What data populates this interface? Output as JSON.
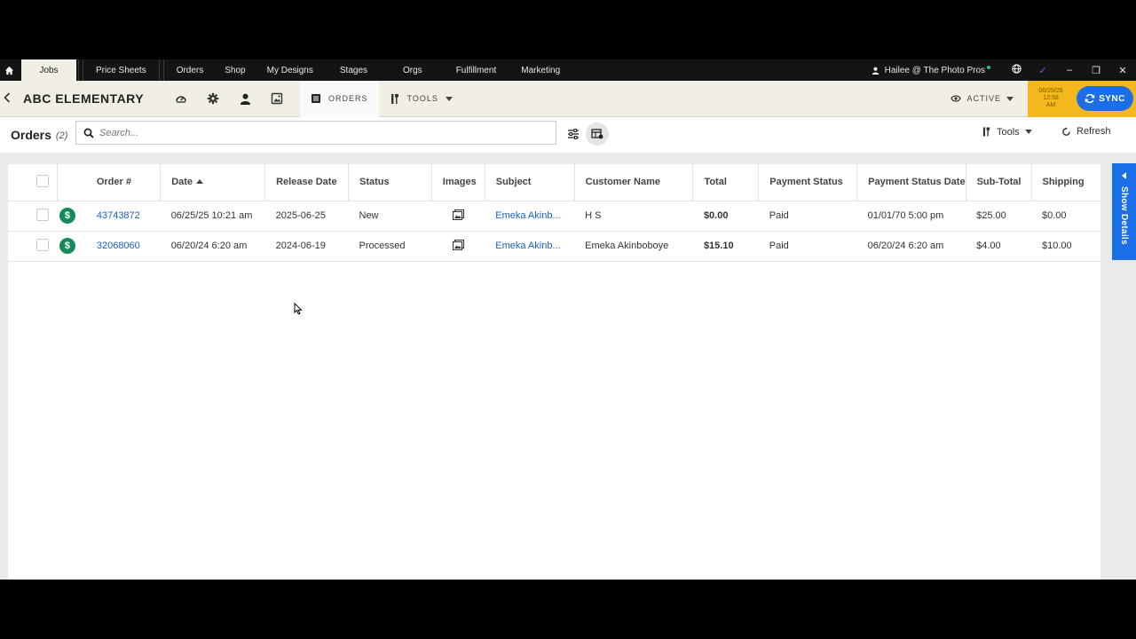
{
  "topnav": {
    "tabs": [
      "Jobs",
      "Price Sheets",
      "Orders",
      "Shop",
      "My Designs",
      "Stages",
      "Orgs",
      "Fulfillment",
      "Marketing"
    ],
    "user": "Hailee @ The Photo Pros"
  },
  "job": {
    "title": "ABC ELEMENTARY",
    "orders_tab": "ORDERS",
    "tools_tab": "TOOLS",
    "status": "ACTIVE",
    "date_line1": "06/25/25",
    "date_line2": "12:58",
    "date_line3": "AM",
    "sync_label": "SYNC"
  },
  "toolbar": {
    "title": "Orders",
    "count": "(2)",
    "search_placeholder": "Search...",
    "tools_label": "Tools",
    "refresh_label": "Refresh"
  },
  "table": {
    "columns": [
      "Order #",
      "Date",
      "Release Date",
      "Status",
      "Images",
      "Subject",
      "Customer Name",
      "Total",
      "Payment Status",
      "Payment Status Date",
      "Sub-Total",
      "Shipping"
    ],
    "rows": [
      {
        "order": "43743872",
        "date": "06/25/25 10:21 am",
        "release": "2025-06-25",
        "status": "New",
        "subject": "Emeka Akinb...",
        "customer": "H S",
        "total": "$0.00",
        "payment_status": "Paid",
        "payment_date": "01/01/70 5:00 pm",
        "subtotal": "$25.00",
        "shipping": "$0.00"
      },
      {
        "order": "32068060",
        "date": "06/20/24 6:20 am",
        "release": "2024-06-19",
        "status": "Processed",
        "subject": "Emeka Akinb...",
        "customer": "Emeka Akinboboye",
        "total": "$15.10",
        "payment_status": "Paid",
        "payment_date": "06/20/24 6:20 am",
        "subtotal": "$4.00",
        "shipping": "$10.00"
      }
    ]
  },
  "side_tab": {
    "label": "Show Details"
  },
  "colors": {
    "accent_blue": "#1a6ee8",
    "date_badge": "#f5b81c",
    "paid_icon": "#168a5a",
    "header_bg": "#f1eee4"
  }
}
